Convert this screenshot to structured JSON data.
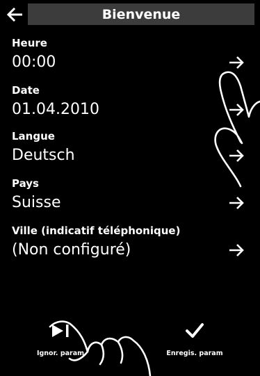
{
  "header": {
    "title": "Bienvenue",
    "back_icon": "left-arrow-icon"
  },
  "settings": [
    {
      "label": "Heure",
      "value": "00:00"
    },
    {
      "label": "Date",
      "value": "01.04.2010"
    },
    {
      "label": "Langue",
      "value": "Deutsch"
    },
    {
      "label": "Pays",
      "value": "Suisse"
    },
    {
      "label": "Ville (indicatif téléphonique)",
      "value": "(Non configuré)"
    }
  ],
  "footer": {
    "skip_label": "Ignor. param",
    "save_label": "Enregis. param",
    "skip_icon": "skip-forward-icon",
    "save_icon": "checkmark-icon"
  },
  "colors": {
    "background": "#000000",
    "title_bar": "#3c3c3c",
    "text": "#ffffff"
  }
}
